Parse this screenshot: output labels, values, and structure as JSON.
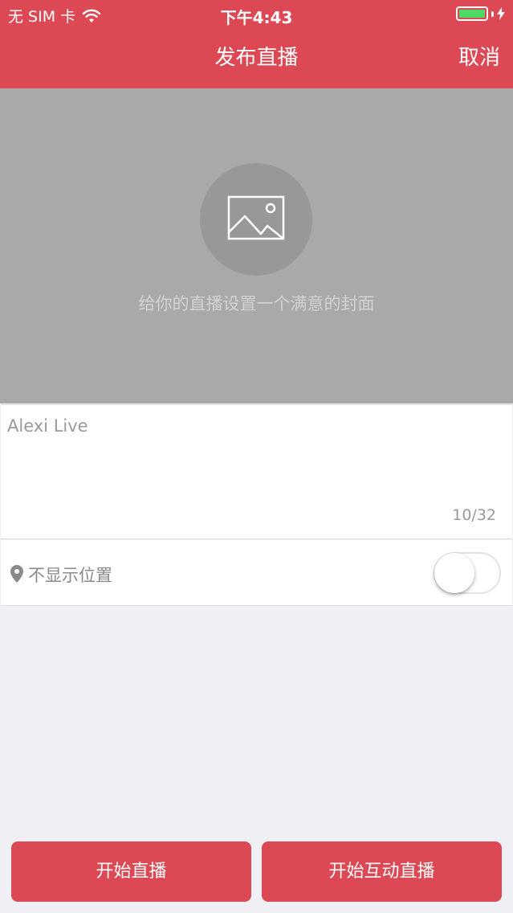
{
  "status_bar": {
    "carrier": "无 SIM 卡",
    "time": "下午4:43",
    "battery_level": 1.0,
    "icons": [
      "wifi-icon",
      "battery-icon",
      "bolt-icon"
    ]
  },
  "nav": {
    "title": "发布直播",
    "cancel_label": "取消"
  },
  "cover": {
    "icon": "image-icon",
    "hint": "给你的直播设置一个满意的封面"
  },
  "live_title": {
    "value": "Alexi Live",
    "count": "10/32"
  },
  "location": {
    "icon": "pin-icon",
    "label": "不显示位置",
    "toggle_on": false
  },
  "buttons": {
    "start": "开始直播",
    "start_interactive": "开始互动直播"
  },
  "colors": {
    "accent": "#dc4853",
    "cover_bg": "#a9a9a9",
    "page_bg": "#efeff4"
  }
}
